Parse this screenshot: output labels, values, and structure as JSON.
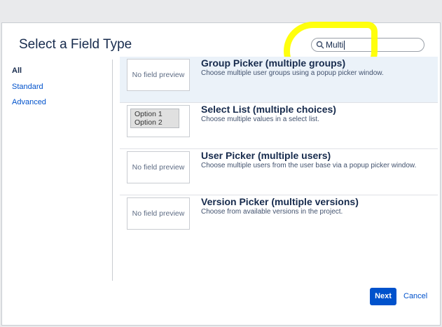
{
  "dialog": {
    "title": "Select a Field Type",
    "search": {
      "value": "Multi",
      "icon": "search-icon"
    }
  },
  "sidebar": {
    "items": [
      {
        "label": "All",
        "active": true
      },
      {
        "label": "Standard",
        "active": false
      },
      {
        "label": "Advanced",
        "active": false
      }
    ]
  },
  "fields": [
    {
      "name": "Group Picker (multiple groups)",
      "description": "Choose multiple user groups using a popup picker window.",
      "preview": "No field preview",
      "selected": true
    },
    {
      "name": "Select List (multiple choices)",
      "description": "Choose multiple values in a select list.",
      "preview_options": [
        "Option 1",
        "Option 2"
      ],
      "selected": false
    },
    {
      "name": "User Picker (multiple users)",
      "description": "Choose multiple users from the user base via a popup picker window.",
      "preview": "No field preview",
      "selected": false
    },
    {
      "name": "Version Picker (multiple versions)",
      "description": "Choose from available versions in the project.",
      "preview": "No field preview",
      "selected": false
    }
  ],
  "footer": {
    "next_label": "Next",
    "cancel_label": "Cancel"
  },
  "colors": {
    "accent": "#0052cc",
    "highlight": "#ffff00",
    "selected_row": "#ebf2f9"
  }
}
